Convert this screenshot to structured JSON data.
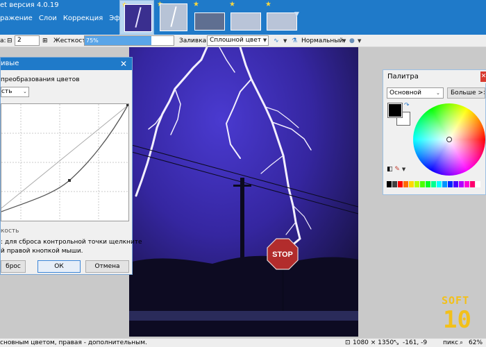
{
  "app": {
    "title": "et версия 4.0.19",
    "menu": [
      "ражение",
      "Слои",
      "Коррекция",
      "Эффекты"
    ]
  },
  "toolbar": {
    "brush_size_prefix": "а:",
    "brush_size": "2",
    "hardness_label": "Жесткость:",
    "hardness_value": "75%",
    "hardness_fraction": 0.75,
    "fill_label": "Заливка:",
    "fill_value": "Сплошной цвет",
    "blend_mode": "Нормальный"
  },
  "curves_dialog": {
    "title": "ивые",
    "section_label": "преобразования цветов",
    "mode_select": "сть",
    "checkbox_label": "кость",
    "hint_line1": ": для сброса контрольной точки щелкните",
    "hint_line2": "й правой кнопкой мыши.",
    "reset_button": "брос",
    "ok_button": "ОК",
    "cancel_button": "Отмена"
  },
  "palette": {
    "title": "Палитра",
    "mode_select": "Основной",
    "more_button": "Больше >>",
    "primary_color": "#000000",
    "secondary_color": "#ffffff",
    "colors": [
      "#000000",
      "#404040",
      "#ff0000",
      "#ff6a00",
      "#ffd800",
      "#b6ff00",
      "#4cff00",
      "#00ff21",
      "#00ff90",
      "#00ffff",
      "#0094ff",
      "#0026ff",
      "#4800ff",
      "#b200ff",
      "#ff00dc",
      "#ff006e",
      "#ffffff"
    ]
  },
  "canvas": {
    "sign_text": "STOP"
  },
  "status": {
    "hint": "сновным цветом, правая - дополнительным.",
    "image_size": "1080 × 1350",
    "cursor_pos": "-161, -9",
    "unit": "пикс",
    "zoom": "62%"
  },
  "watermark": {
    "line1": "SOFT",
    "line2": "10"
  },
  "colors": {
    "accent": "#1f7ac9",
    "watermark": "#f2c01a"
  }
}
